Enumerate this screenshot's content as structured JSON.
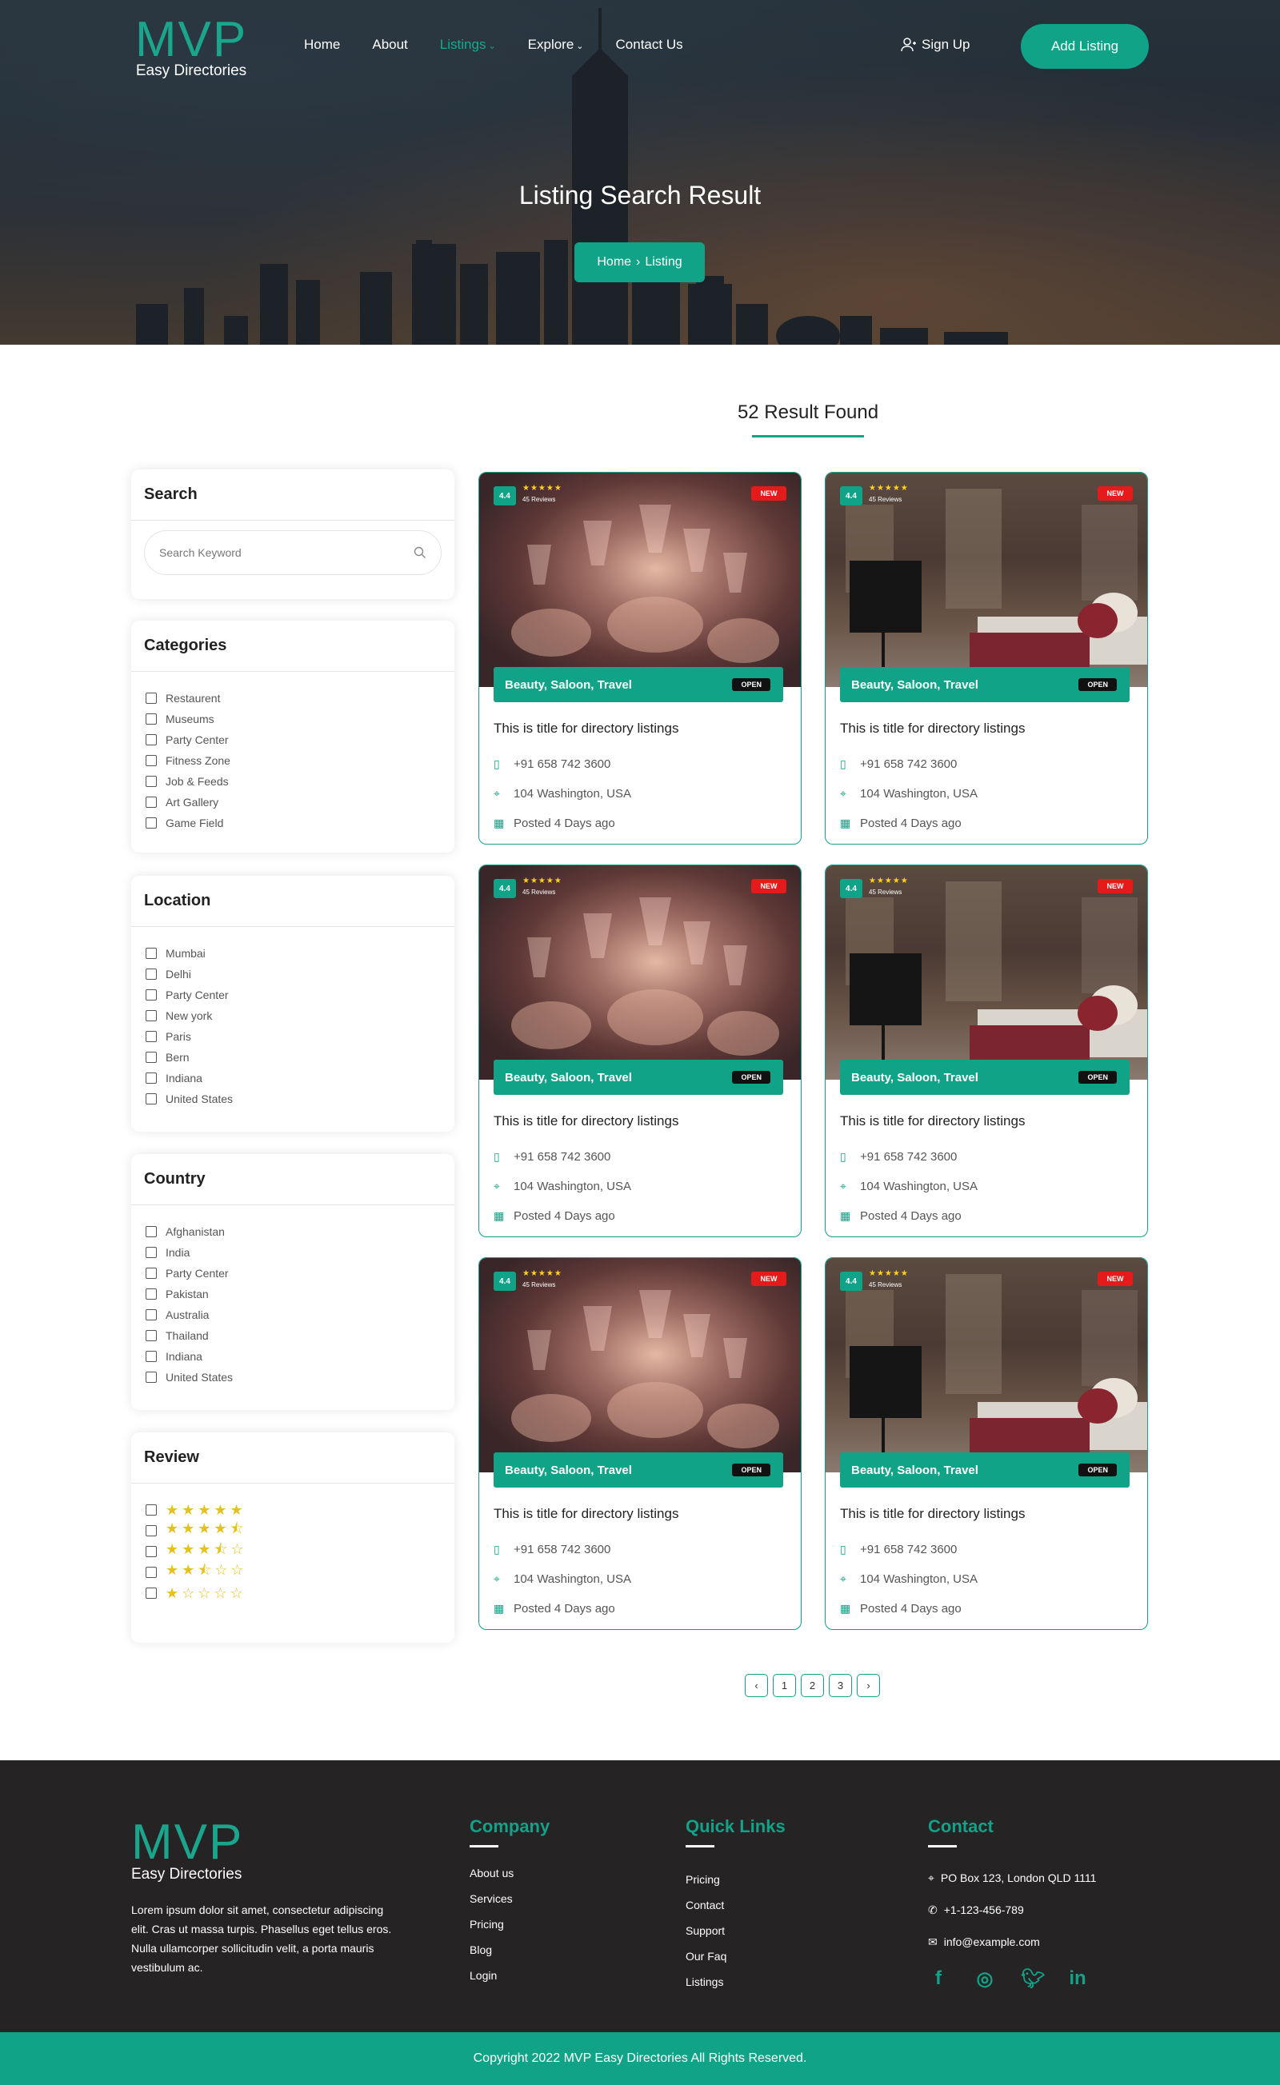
{
  "brand": {
    "logo": "MVP",
    "tagline": "Easy Directories",
    "accent": "#11a387"
  },
  "nav": {
    "items": [
      {
        "label": "Home",
        "caret": false
      },
      {
        "label": "About",
        "caret": false
      },
      {
        "label": "Listings",
        "caret": true,
        "active": true
      },
      {
        "label": "Explore",
        "caret": true
      },
      {
        "label": "Contact Us",
        "caret": false
      }
    ],
    "signup": "Sign Up",
    "add_listing": "Add Listing"
  },
  "hero": {
    "title": "Listing Search Result",
    "breadcrumb": [
      "Home",
      "Listing"
    ]
  },
  "results": {
    "count_text": "52 Result Found"
  },
  "sidebar": {
    "search": {
      "title": "Search",
      "placeholder": "Search Keyword"
    },
    "categories": {
      "title": "Categories",
      "items": [
        "Restaurent",
        "Museums",
        "Party Center",
        "Fitness Zone",
        "Job & Feeds",
        "Art Gallery",
        "Game Field"
      ]
    },
    "location": {
      "title": "Location",
      "items": [
        "Mumbai",
        "Delhi",
        "Party Center",
        "New york",
        "Paris",
        "Bern",
        "Indiana",
        "United States"
      ]
    },
    "country": {
      "title": "Country",
      "items": [
        "Afghanistan",
        "India",
        "Party Center",
        "Pakistan",
        "Australia",
        "Thailand",
        "Indiana",
        "United States"
      ]
    },
    "review": {
      "title": "Review",
      "ratings": [
        5,
        4.5,
        3.5,
        2.5,
        1
      ]
    }
  },
  "listings": [
    {
      "image": "party",
      "rating": "4.4",
      "reviews": "45 Reviews",
      "badge": "NEW",
      "categories": "Beauty, Saloon, Travel",
      "status": "OPEN",
      "title": "This is title for directory listings",
      "phone": "+91 658 742 3600",
      "address": "104 Washington, USA",
      "posted": "Posted 4 Days ago"
    },
    {
      "image": "room",
      "rating": "4.4",
      "reviews": "45 Reviews",
      "badge": "NEW",
      "categories": "Beauty, Saloon, Travel",
      "status": "OPEN",
      "title": "This is title for directory listings",
      "phone": "+91 658 742 3600",
      "address": "104 Washington, USA",
      "posted": "Posted 4 Days ago"
    },
    {
      "image": "party",
      "rating": "4.4",
      "reviews": "45 Reviews",
      "badge": "NEW",
      "categories": "Beauty, Saloon, Travel",
      "status": "OPEN",
      "title": "This is title for directory listings",
      "phone": "+91 658 742 3600",
      "address": "104 Washington, USA",
      "posted": "Posted 4 Days ago"
    },
    {
      "image": "room",
      "rating": "4.4",
      "reviews": "45 Reviews",
      "badge": "NEW",
      "categories": "Beauty, Saloon, Travel",
      "status": "OPEN",
      "title": "This is title for directory listings",
      "phone": "+91 658 742 3600",
      "address": "104 Washington, USA",
      "posted": "Posted 4 Days ago"
    },
    {
      "image": "party",
      "rating": "4.4",
      "reviews": "45 Reviews",
      "badge": "NEW",
      "categories": "Beauty, Saloon, Travel",
      "status": "OPEN",
      "title": "This is title for directory listings",
      "phone": "+91 658 742 3600",
      "address": "104 Washington, USA",
      "posted": "Posted 4 Days ago"
    },
    {
      "image": "room",
      "rating": "4.4",
      "reviews": "45 Reviews",
      "badge": "NEW",
      "categories": "Beauty, Saloon, Travel",
      "status": "OPEN",
      "title": "This is title for directory listings",
      "phone": "+91 658 742 3600",
      "address": "104 Washington, USA",
      "posted": "Posted 4 Days ago"
    }
  ],
  "pagination": {
    "prev": "‹",
    "pages": [
      "1",
      "2",
      "3"
    ],
    "next": "›"
  },
  "footer": {
    "logo": "MVP",
    "tagline": "Easy Directories",
    "about": "Lorem ipsum dolor sit amet, consectetur adipiscing elit. Cras ut massa turpis. Phasellus eget tellus eros. Nulla ullamcorper sollicitudin velit, a porta mauris vestibulum ac.",
    "company": {
      "title": "Company",
      "links": [
        "About us",
        "Services",
        "Pricing",
        "Blog",
        "Login"
      ]
    },
    "quick_links": {
      "title": "Quick Links",
      "links": [
        "Pricing",
        "Contact",
        "Support",
        "Our Faq",
        "Listings"
      ]
    },
    "contact": {
      "title": "Contact",
      "address": "PO Box 123, London QLD 1111",
      "phone": "+1-123-456-789",
      "email": "info@example.com"
    },
    "socials": [
      "facebook-icon",
      "instagram-icon",
      "twitter-icon",
      "linkedin-icon"
    ],
    "copyright": "Copyright 2022 MVP Easy Directories All Rights Reserved."
  }
}
